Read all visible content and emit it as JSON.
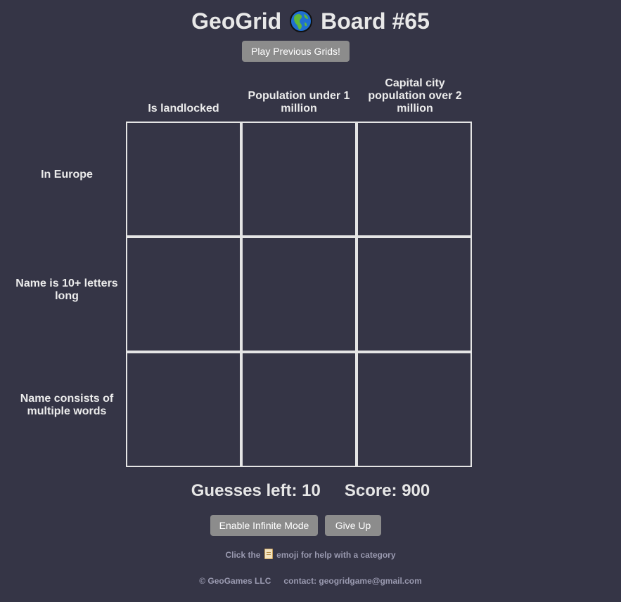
{
  "header": {
    "app_name": "GeoGrid",
    "board_label": "Board #65",
    "globe_icon": "globe-americas-icon"
  },
  "buttons": {
    "previous_grids": "Play Previous Grids!",
    "infinite_mode": "Enable Infinite Mode",
    "give_up": "Give Up"
  },
  "columns": [
    {
      "label": "Is landlocked"
    },
    {
      "label": "Population under 1 million"
    },
    {
      "label": "Capital city population over 2 million"
    }
  ],
  "rows": [
    {
      "label": "In Europe"
    },
    {
      "label": "Name is 10+ letters long"
    },
    {
      "label": "Name consists of multiple words"
    }
  ],
  "stats": {
    "guesses_text": "Guesses left: 10",
    "score_text": "Score: 900"
  },
  "help": {
    "before": "Click the",
    "icon": "scroll-icon",
    "after": "emoji for help with a category"
  },
  "footer": {
    "copyright": "© GeoGames LLC",
    "contact": "contact: geogridgame@gmail.com"
  },
  "colors": {
    "background": "#353546",
    "button": "#8c8c8c",
    "grid_border": "#e5e5e5",
    "muted_text": "#9a9ab0"
  }
}
